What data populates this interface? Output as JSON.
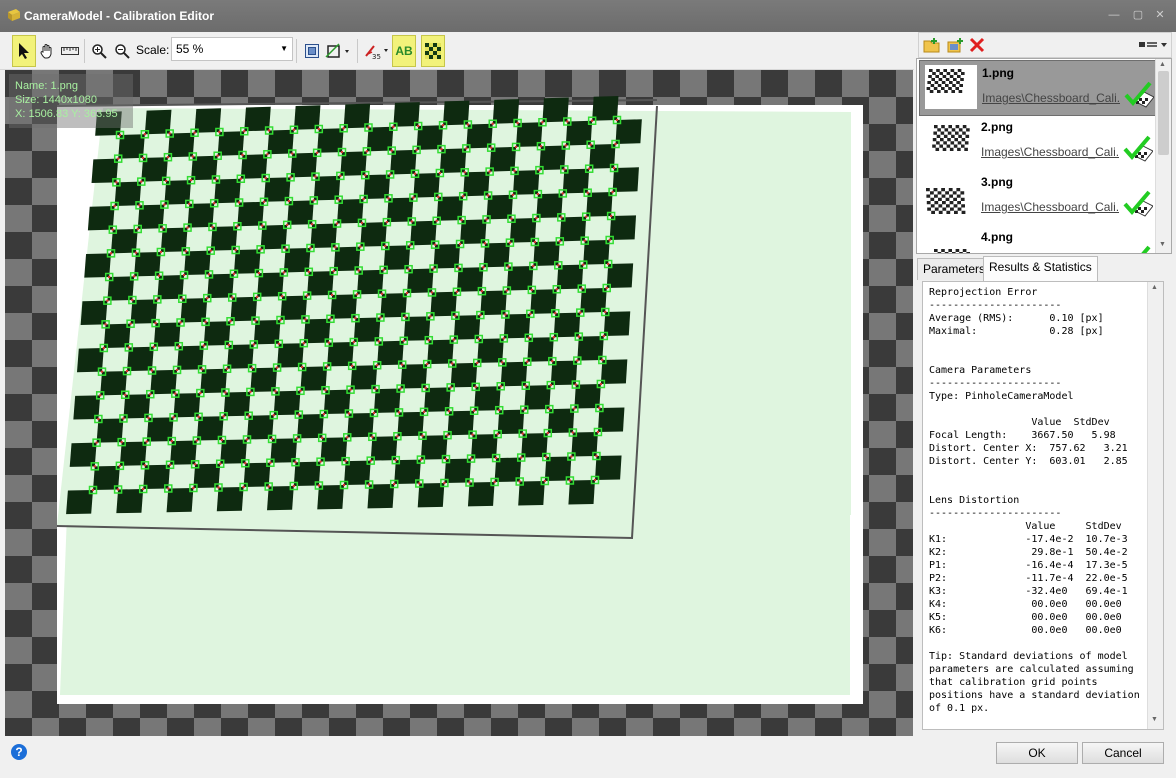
{
  "window": {
    "title": "CameraModel - Calibration Editor",
    "controls": [
      "minimize-icon",
      "maximize-icon",
      "close-icon"
    ]
  },
  "toolbar": {
    "tools": [
      "select-arrow-icon",
      "hand-pan-icon",
      "ruler-icon",
      "zoom-in-icon",
      "zoom-out-icon"
    ],
    "scale_label": "Scale:",
    "scale_value": "55 %",
    "view_tools": [
      "fit-to-window-icon",
      "crop-rotate-icon",
      "grid-points-icon"
    ],
    "ab_label": "AB",
    "checker_toggle": "checkerboard-icon",
    "active_tools": [
      "select-arrow-icon",
      "ab-labels",
      "checkerboard-icon"
    ]
  },
  "canvas": {
    "info": {
      "name": "Name: 1.png",
      "size": "Size: 1440x1080",
      "cursor": "X: 1506.83 Y: 363.95"
    }
  },
  "image_list": {
    "toolbar_icons": [
      "add-folder-icon",
      "add-images-icon",
      "delete-icon",
      "view-options-icon"
    ],
    "items": [
      {
        "name": "1.png",
        "path": "Images\\Chessboard_Cali...",
        "status": "calibrated-check-icon",
        "selected": true
      },
      {
        "name": "2.png",
        "path": "Images\\Chessboard_Cali...",
        "status": "calibrated-check-icon",
        "selected": false
      },
      {
        "name": "3.png",
        "path": "Images\\Chessboard_Cali...",
        "status": "calibrated-check-icon",
        "selected": false
      },
      {
        "name": "4.png",
        "path": "",
        "status": "calibrated-check-icon",
        "selected": false
      }
    ]
  },
  "tabs": [
    {
      "label": "Parameters",
      "active": false
    },
    {
      "label": "Results & Statistics",
      "active": true
    }
  ],
  "results": {
    "text": "Reprojection Error\n----------------------\nAverage (RMS):      0.10 [px]\nMaximal:            0.28 [px]\n\n\nCamera Parameters\n----------------------\nType: PinholeCameraModel\n\n                 Value  StdDev\nFocal Length:    3667.50   5.98\nDistort. Center X:  757.62   3.21\nDistort. Center Y:  603.01   2.85\n\n\nLens Distortion\n----------------------\n                Value     StdDev\nK1:             -17.4e-2  10.7e-3\nK2:              29.8e-1  50.4e-2\nP1:             -16.4e-4  17.3e-5\nP2:             -11.7e-4  22.0e-5\nK3:             -32.4e0   69.4e-1\nK4:              00.0e0   00.0e0\nK5:              00.0e0   00.0e0\nK6:              00.0e0   00.0e0\n\nTip: Standard deviations of model\nparameters are calculated assuming\nthat calibration grid points\npositions have a standard deviation\nof 0.1 px."
  },
  "footer": {
    "help_icon": "help-icon",
    "help_glyph": "?",
    "ok_label": "OK",
    "cancel_label": "Cancel"
  },
  "colors": {
    "active_tool": "#f2f27a",
    "corner_marker": "#33dd33",
    "checker_dark": "#0e2a10",
    "board_overlay": "#dff5df",
    "check_green": "#22cc22"
  }
}
